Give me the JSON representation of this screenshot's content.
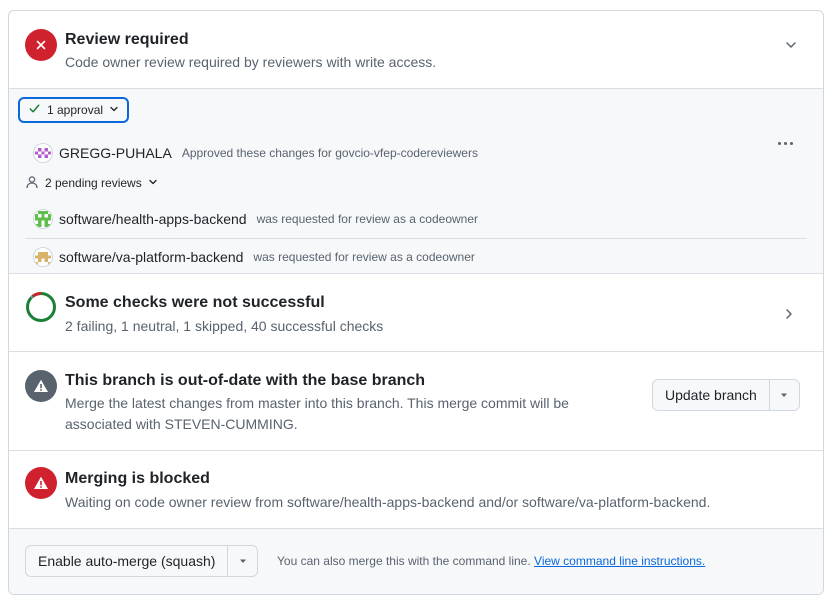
{
  "review": {
    "title": "Review required",
    "subtitle": "Code owner review required by reviewers with write access."
  },
  "reviewers": {
    "approval_label": "1 approval",
    "approved": [
      {
        "name": "GREGG-PUHALA",
        "note": "Approved these changes for govcio-vfep-codereviewers"
      }
    ],
    "pending_label": "2 pending reviews",
    "pending": [
      {
        "name": "software/health-apps-backend",
        "note": "was requested for review as a codeowner"
      },
      {
        "name": "software/va-platform-backend",
        "note": "was requested for review as a codeowner"
      }
    ]
  },
  "checks": {
    "title": "Some checks were not successful",
    "subtitle": "2 failing, 1 neutral, 1 skipped, 40 successful checks"
  },
  "branch": {
    "title": "This branch is out-of-date with the base branch",
    "subtitle": "Merge the latest changes from master into this branch. This merge commit will be associated with STEVEN-CUMMING.",
    "update_label": "Update branch"
  },
  "blocked": {
    "title": "Merging is blocked",
    "subtitle": "Waiting on code owner review from software/health-apps-backend and/or software/va-platform-backend."
  },
  "merge": {
    "button_label": "Enable auto-merge (squash)",
    "note": "You can also merge this with the command line.",
    "link_label": "View command line instructions."
  },
  "colors": {
    "danger": "#cf222e",
    "success": "#1a7f37",
    "neutral": "#59636e",
    "accent": "#0969da"
  }
}
